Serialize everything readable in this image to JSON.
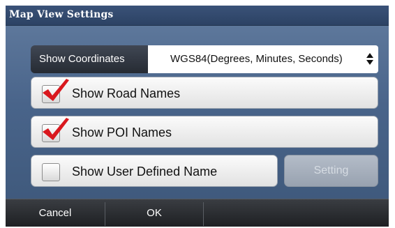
{
  "window": {
    "title": "Map View Settings"
  },
  "coordinates": {
    "label": "Show Coordinates",
    "value": "WGS84(Degrees, Minutes, Seconds)"
  },
  "options": [
    {
      "label": "Show Road Names",
      "checked": true
    },
    {
      "label": "Show POI Names",
      "checked": true
    },
    {
      "label": "Show User Defined Name",
      "checked": false
    }
  ],
  "setting_button": {
    "label": "Setting",
    "enabled": false
  },
  "footer": {
    "cancel_label": "Cancel",
    "ok_label": "OK"
  },
  "colors": {
    "check_mark": "#d9181e",
    "title_bar": "#2f456a",
    "panel": "#4c6790"
  },
  "icons": {
    "checkmark": "check-icon",
    "select_arrows": "up-down-arrows-icon"
  }
}
